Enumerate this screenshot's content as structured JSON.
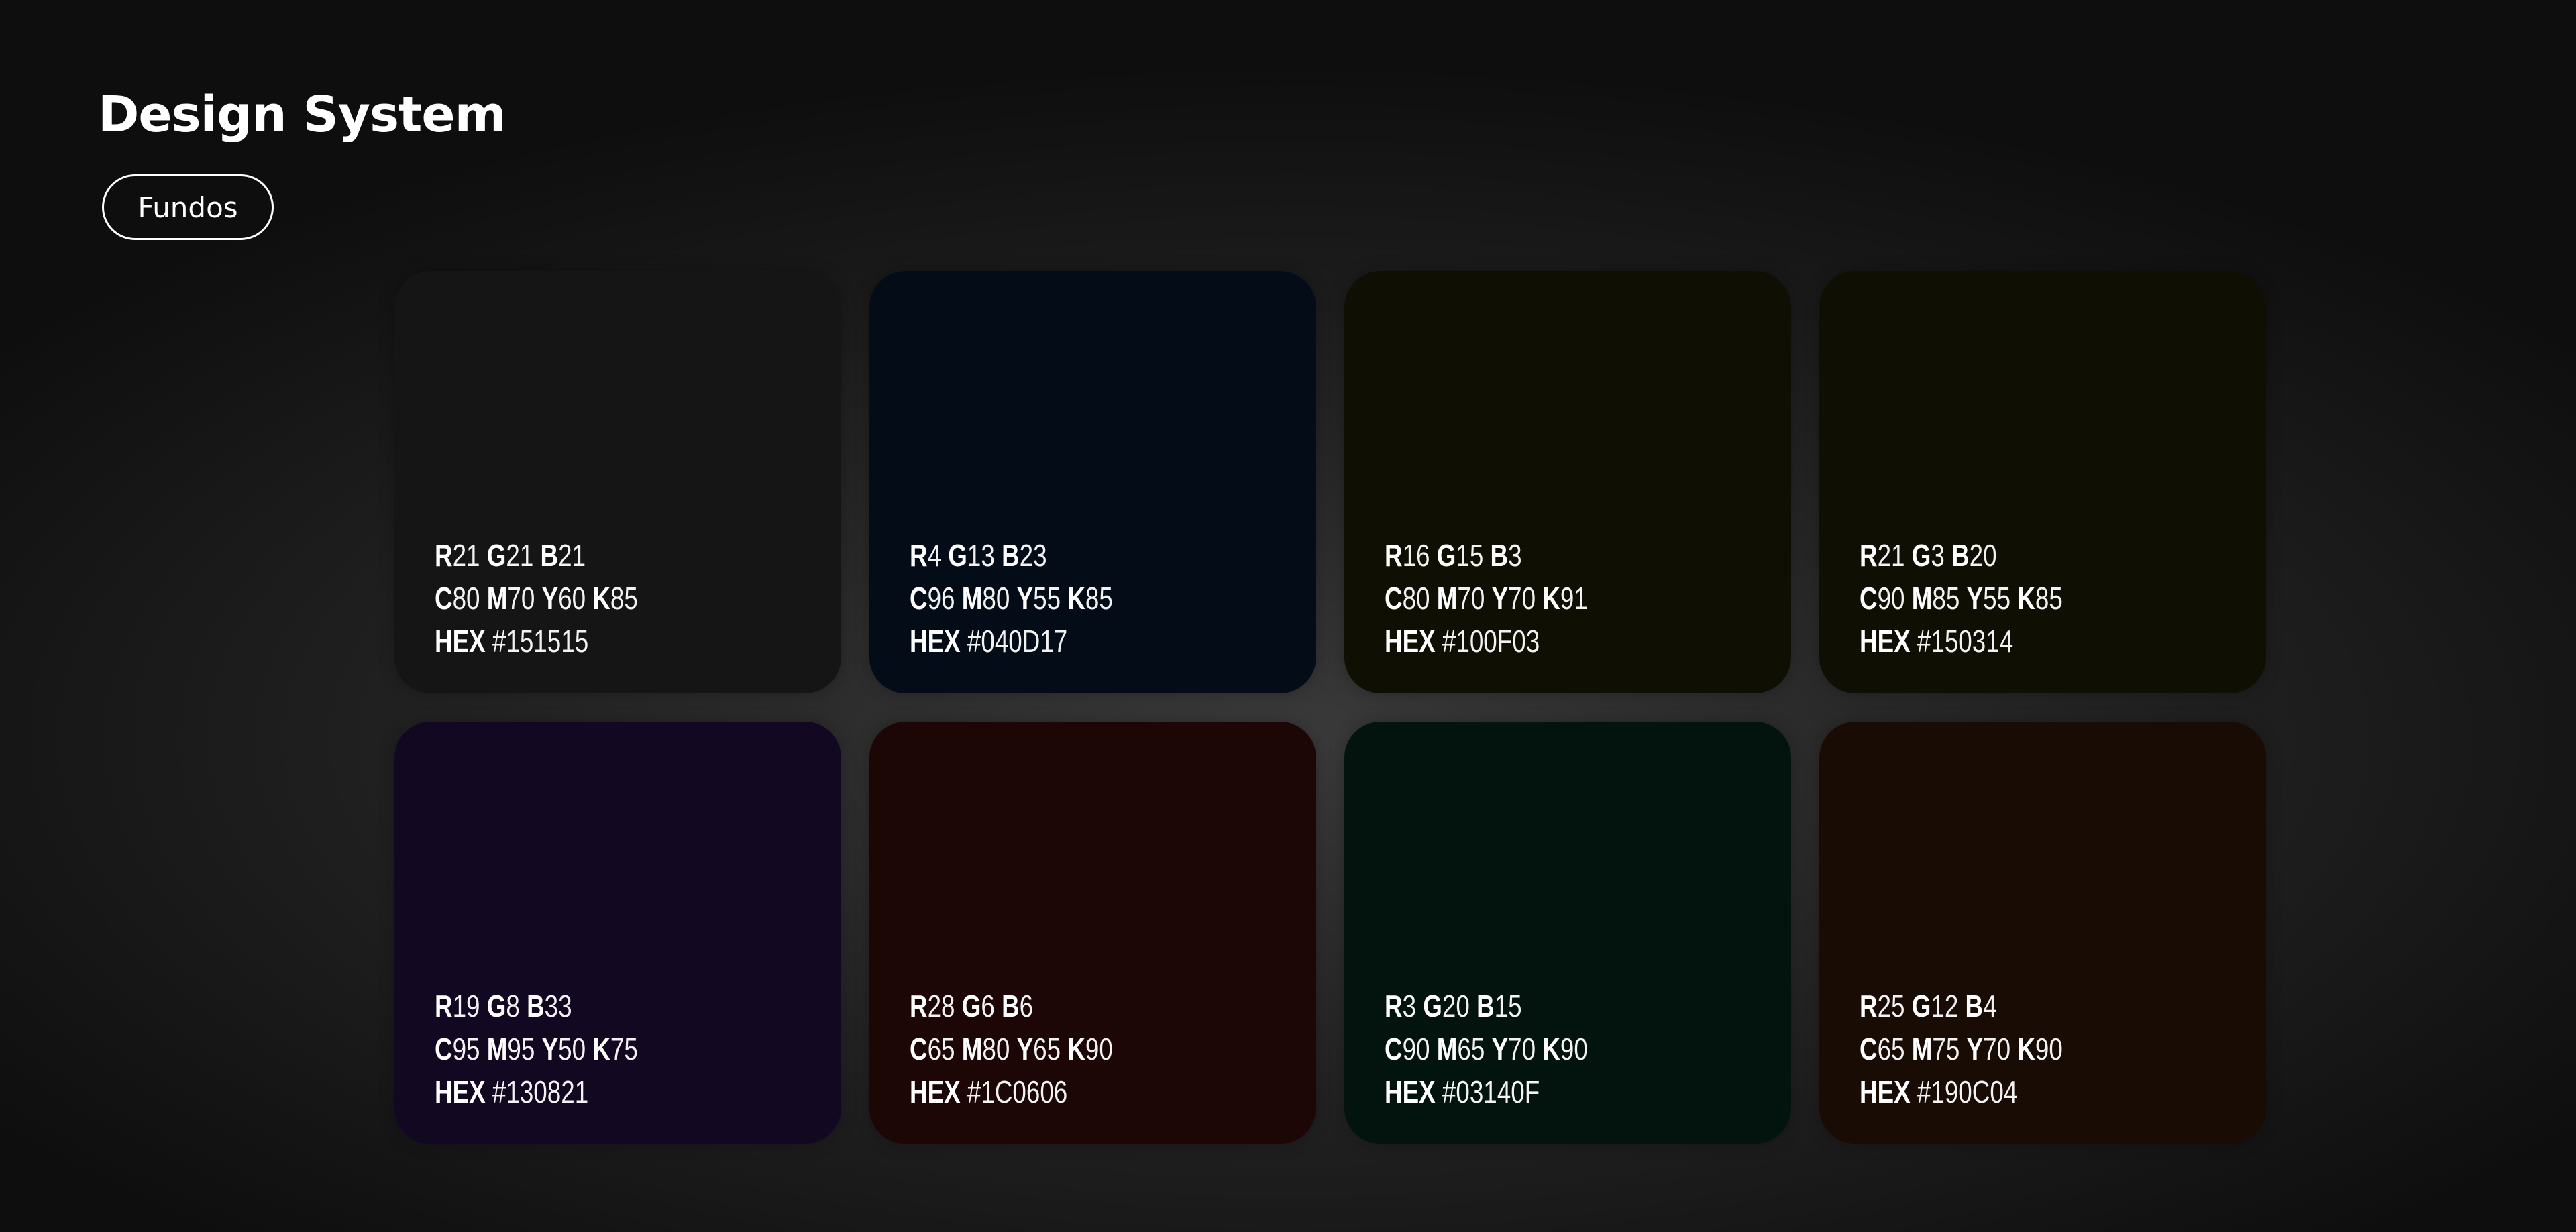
{
  "header": {
    "title": "Design System",
    "tag_label": "Fundos"
  },
  "labels": {
    "r": "R",
    "g": "G",
    "b": "B",
    "c": "C",
    "m": "M",
    "y": "Y",
    "k": "K",
    "hex": "HEX"
  },
  "swatches": [
    {
      "color": "#151515",
      "r": "21",
      "g": "21",
      "b": "21",
      "c": "80",
      "m": "70",
      "y": "60",
      "k": "85",
      "hex": "#151515"
    },
    {
      "color": "#040D17",
      "r": "4",
      "g": "13",
      "b": "23",
      "c": "96",
      "m": "80",
      "y": "55",
      "k": "85",
      "hex": "#040D17"
    },
    {
      "color": "#100F03",
      "r": "16",
      "g": "15",
      "b": "3",
      "c": "80",
      "m": "70",
      "y": "70",
      "k": "91",
      "hex": "#100F03"
    },
    {
      "color": "#100F03",
      "r": "21",
      "g": "3",
      "b": "20",
      "c": "90",
      "m": "85",
      "y": "55",
      "k": "85",
      "hex": "#150314"
    },
    {
      "color": "#130821",
      "r": "19",
      "g": "8",
      "b": "33",
      "c": "95",
      "m": "95",
      "y": "50",
      "k": "75",
      "hex": "#130821"
    },
    {
      "color": "#1C0606",
      "r": "28",
      "g": "6",
      "b": "6",
      "c": "65",
      "m": "80",
      "y": "65",
      "k": "90",
      "hex": "#1C0606"
    },
    {
      "color": "#03140F",
      "r": "3",
      "g": "20",
      "b": "15",
      "c": "90",
      "m": "65",
      "y": "70",
      "k": "90",
      "hex": "#03140F"
    },
    {
      "color": "#190C04",
      "r": "25",
      "g": "12",
      "b": "4",
      "c": "65",
      "m": "75",
      "y": "70",
      "k": "90",
      "hex": "#190C04"
    }
  ]
}
